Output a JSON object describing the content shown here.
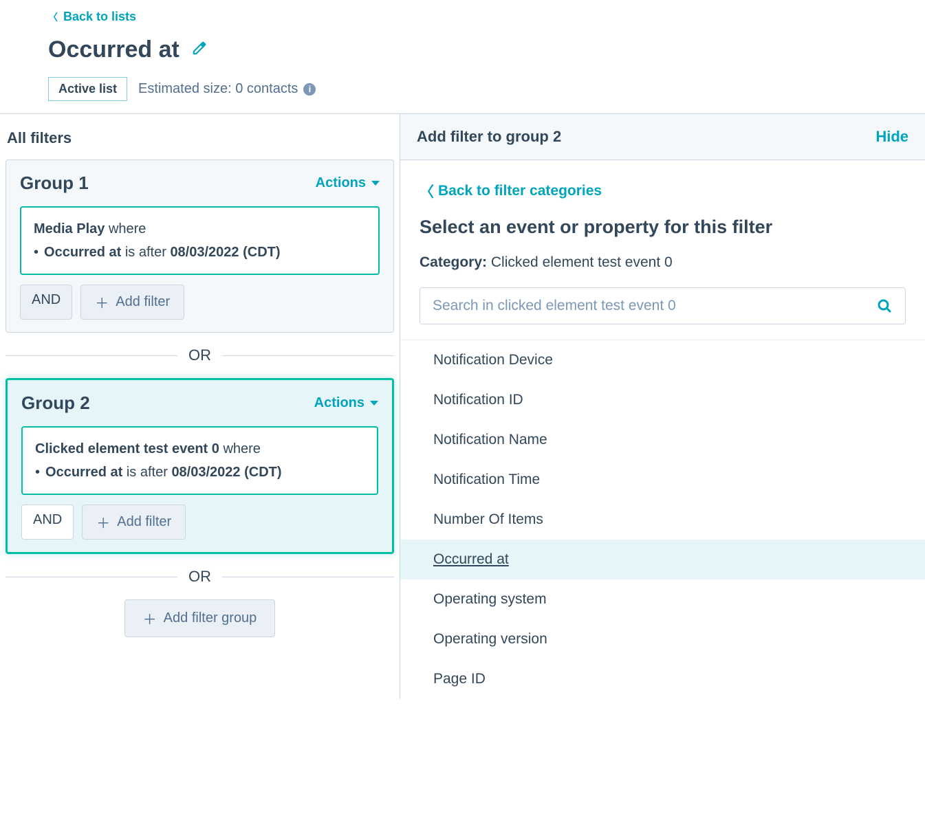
{
  "header": {
    "back_label": "Back to lists",
    "title": "Occurred at",
    "active_badge": "Active list",
    "estimated_size": "Estimated size: 0 contacts"
  },
  "left": {
    "heading": "All filters",
    "or_label": "OR",
    "add_group_label": "Add filter group",
    "groups": [
      {
        "title": "Group 1",
        "actions_label": "Actions",
        "and_label": "AND",
        "add_filter_label": "Add filter",
        "filter": {
          "event": "Media Play",
          "where": "where",
          "prop": "Occurred at",
          "op_text": "is after",
          "value": "08/03/2022 (CDT)"
        }
      },
      {
        "title": "Group 2",
        "actions_label": "Actions",
        "and_label": "AND",
        "add_filter_label": "Add filter",
        "filter": {
          "event": "Clicked element test event 0",
          "where": "where",
          "prop": "Occurred at",
          "op_text": "is after",
          "value": "08/03/2022 (CDT)"
        }
      }
    ]
  },
  "right": {
    "head_title": "Add filter to group 2",
    "hide_label": "Hide",
    "back_label": "Back to filter categories",
    "select_heading": "Select an event or property for this filter",
    "category_label": "Category:",
    "category_value": "Clicked element test event 0",
    "search_placeholder": "Search in clicked element test event 0",
    "properties": [
      "Notification Device",
      "Notification ID",
      "Notification Name",
      "Notification Time",
      "Number Of Items",
      "Occurred at",
      "Operating system",
      "Operating version",
      "Page ID"
    ],
    "highlight_index": 5
  }
}
